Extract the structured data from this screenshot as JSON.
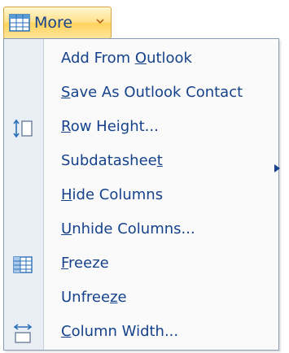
{
  "toolbar": {
    "more_label": "More"
  },
  "menu": {
    "items": [
      {
        "pre": "Add From ",
        "key": "O",
        "post": "utlook"
      },
      {
        "pre": "",
        "key": "S",
        "post": "ave As Outlook Contact"
      },
      {
        "pre": "",
        "key": "R",
        "post": "ow Height..."
      },
      {
        "pre": "Subdatashee",
        "key": "t",
        "post": ""
      },
      {
        "pre": "",
        "key": "H",
        "post": "ide Columns"
      },
      {
        "pre": "",
        "key": "U",
        "post": "nhide Columns..."
      },
      {
        "pre": "",
        "key": "F",
        "post": "reeze"
      },
      {
        "pre": "Unfree",
        "key": "z",
        "post": "e"
      },
      {
        "pre": "",
        "key": "C",
        "post": "olumn Width..."
      }
    ]
  },
  "icons": {
    "toolbar": "table-icon",
    "row_height": "row-height-icon",
    "freeze": "freeze-grid-icon",
    "column_width": "column-width-icon",
    "submenu": "submenu-arrow-icon",
    "dropdown": "chevron-down-icon"
  },
  "colors": {
    "text": "#15428b",
    "button_border": "#d8a447",
    "gutter": "#e9eef4"
  }
}
